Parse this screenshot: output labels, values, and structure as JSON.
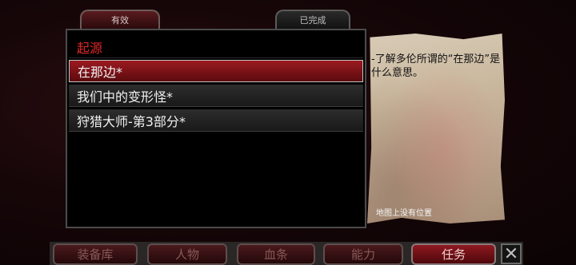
{
  "tabs": {
    "active": "有效",
    "completed": "已完成"
  },
  "quest_list": {
    "header": "起源",
    "items": [
      {
        "label": "在那边*",
        "selected": true
      },
      {
        "label": "我们中的变形怪*",
        "selected": false
      },
      {
        "label": "狩猎大师-第3部分*",
        "selected": false
      }
    ]
  },
  "details": {
    "description": "-了解多伦所谓的“在那边”是什么意思。",
    "location_note": "地图上没有位置"
  },
  "nav": {
    "items": [
      {
        "label": "装备库",
        "active": false
      },
      {
        "label": "人物",
        "active": false
      },
      {
        "label": "血条",
        "active": false
      },
      {
        "label": "能力",
        "active": false
      },
      {
        "label": "任务",
        "active": true
      }
    ],
    "close_icon": "close-icon"
  },
  "colors": {
    "header_red": "#e02828",
    "selected_row": "#9b1a20"
  }
}
